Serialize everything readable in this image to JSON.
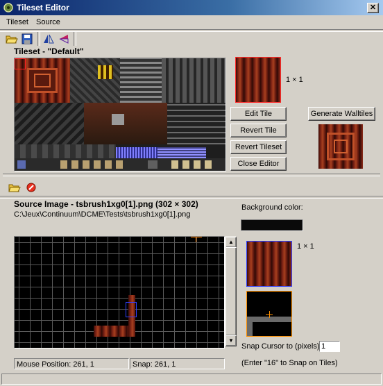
{
  "window": {
    "title": "Tileset Editor",
    "close_glyph": "✕"
  },
  "menu": [
    "Tileset",
    "Source"
  ],
  "tileset": {
    "heading": "Tileset - \"Default\"",
    "tile_size_label": "1 × 1",
    "buttons": {
      "edit": "Edit Tile",
      "revert_tile": "Revert Tile",
      "revert_tileset": "Revert Tileset",
      "close": "Close Editor",
      "walltiles": "Generate Walltiles"
    }
  },
  "source": {
    "heading": "Source Image - tsbrush1xg0[1].png (302 × 302)",
    "path": "C:\\Jeux\\Continuum\\DCME\\Tests\\tsbrush1xg0[1].png",
    "background_color_label": "Background color:",
    "background_color": "#0a0a0a",
    "selection_size_label": "1 × 1",
    "snap_label": "Snap Cursor to (pixels):",
    "snap_value": "1",
    "snap_hint": "(Enter \"16\" to Snap on Tiles)",
    "mouse_position": "Mouse Position: 261, 1",
    "snap_status": "Snap: 261, 1"
  },
  "icons": {
    "open": "folder-open-icon",
    "save": "save-icon",
    "flip_h": "flip-horizontal-icon",
    "flip_v": "flip-vertical-icon",
    "cancel": "cancel-icon"
  }
}
